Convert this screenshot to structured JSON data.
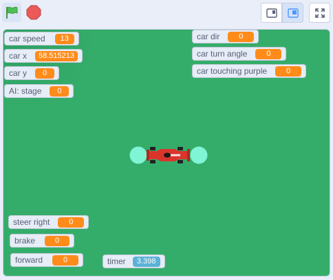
{
  "toolbar": {
    "green_flag_icon": "green-flag-icon",
    "stop_icon": "stop-sign-icon",
    "small_stage_icon": "small-stage-icon",
    "large_stage_icon": "large-stage-icon",
    "fullscreen_icon": "fullscreen-icon"
  },
  "colors": {
    "stage_bg": "#35ad6a",
    "monitor_value_orange": "#ff8c1a",
    "monitor_value_blue": "#5cb1d6",
    "sensor_circle": "#7ff5d6",
    "car_red": "#d9352c"
  },
  "monitors": {
    "car_speed": {
      "label": "car speed",
      "value": "13"
    },
    "car_x": {
      "label": "car x",
      "value": "58.515213"
    },
    "car_y": {
      "label": "car y",
      "value": "0"
    },
    "ai_stage": {
      "label": "AI: stage",
      "value": "0"
    },
    "car_dir": {
      "label": "car dir",
      "value": "0"
    },
    "car_turn_angle": {
      "label": "car turn angle",
      "value": "0"
    },
    "car_touching_purple": {
      "label": "car touching purple",
      "value": "0"
    },
    "steer_right": {
      "label": "steer right",
      "value": "0"
    },
    "brake": {
      "label": "brake",
      "value": "0"
    },
    "forward": {
      "label": "forward",
      "value": "0"
    },
    "timer": {
      "label": "timer",
      "value": "3.398"
    }
  }
}
